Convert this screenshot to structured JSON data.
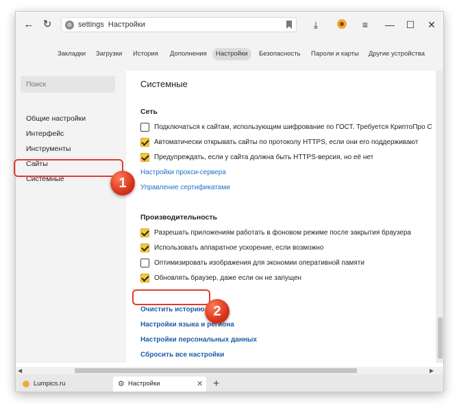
{
  "toolbar": {
    "address_domain": "settings",
    "address_title": "Настройки"
  },
  "settings_tabs": [
    "Закладки",
    "Загрузки",
    "История",
    "Дополнения",
    "Настройки",
    "Безопасность",
    "Пароли и карты",
    "Другие устройства"
  ],
  "settings_tab_active": "Настройки",
  "sidebar": {
    "search_placeholder": "Поиск",
    "items": [
      "Общие настройки",
      "Интерфейс",
      "Инструменты",
      "Сайты",
      "Системные"
    ],
    "selected": "Системные"
  },
  "main": {
    "section_title": "Системные",
    "network": {
      "title": "Сеть",
      "options": [
        {
          "label": "Подключаться к сайтам, использующим шифрование по ГОСТ. Требуется КриптоПро С",
          "checked": false
        },
        {
          "label": "Автоматически открывать сайты по протоколу HTTPS, если они его поддерживают",
          "checked": true
        },
        {
          "label": "Предупреждать, если у сайта должна быть HTTPS-версия, но её нет",
          "checked": true
        }
      ],
      "links": [
        "Настройки прокси-сервера",
        "Управление сертификатами"
      ]
    },
    "performance": {
      "title": "Производительность",
      "options": [
        {
          "label": "Разрешать приложениям работать в фоновом режиме после закрытия браузера",
          "checked": true
        },
        {
          "label": "Использовать аппаратное ускорение, если возможно",
          "checked": true
        },
        {
          "label": "Оптимизировать изображения для экономии оперативной памяти",
          "checked": false
        },
        {
          "label": "Обновлять браузер, даже если он не запущен",
          "checked": true
        }
      ]
    },
    "bottom_links": [
      "Очистить историю",
      "Настройки языка и региона",
      "Настройки персональных данных",
      "Сбросить все настройки"
    ]
  },
  "browser_tabs": [
    {
      "title": "Lumpics.ru",
      "active": false
    },
    {
      "title": "Настройки",
      "active": true
    }
  ],
  "annotations": {
    "step1": "1",
    "step2": "2"
  },
  "colors": {
    "accent_link": "#1e6fc9",
    "checkbox_on": "#f6c736",
    "annotation_red": "#e03a2f"
  }
}
